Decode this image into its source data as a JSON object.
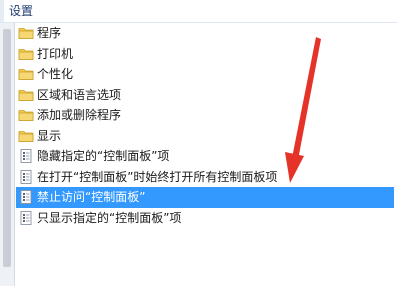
{
  "header": {
    "title": "设置"
  },
  "tree": {
    "items": [
      {
        "label": "程序",
        "icon": "folder-icon",
        "selected": false
      },
      {
        "label": "打印机",
        "icon": "folder-icon",
        "selected": false
      },
      {
        "label": "个性化",
        "icon": "folder-icon",
        "selected": false
      },
      {
        "label": "区域和语言选项",
        "icon": "folder-icon",
        "selected": false
      },
      {
        "label": "添加或删除程序",
        "icon": "folder-icon",
        "selected": false
      },
      {
        "label": "显示",
        "icon": "folder-icon",
        "selected": false
      },
      {
        "label": "隐藏指定的“控制面板”项",
        "icon": "policy-setting-icon",
        "selected": false
      },
      {
        "label": "在打开“控制面板”时始终打开所有控制面板项",
        "icon": "policy-setting-icon",
        "selected": false
      },
      {
        "label": "禁止访问“控制面板”",
        "icon": "policy-setting-icon",
        "selected": true
      },
      {
        "label": "只显示指定的“控制面板”项",
        "icon": "policy-setting-icon",
        "selected": false
      }
    ]
  },
  "colors": {
    "selection": "#3399ff",
    "folder": "#f2c94c",
    "annotation_arrow": "#e5332a"
  },
  "annotation": {
    "icon": "red-arrow-icon"
  }
}
